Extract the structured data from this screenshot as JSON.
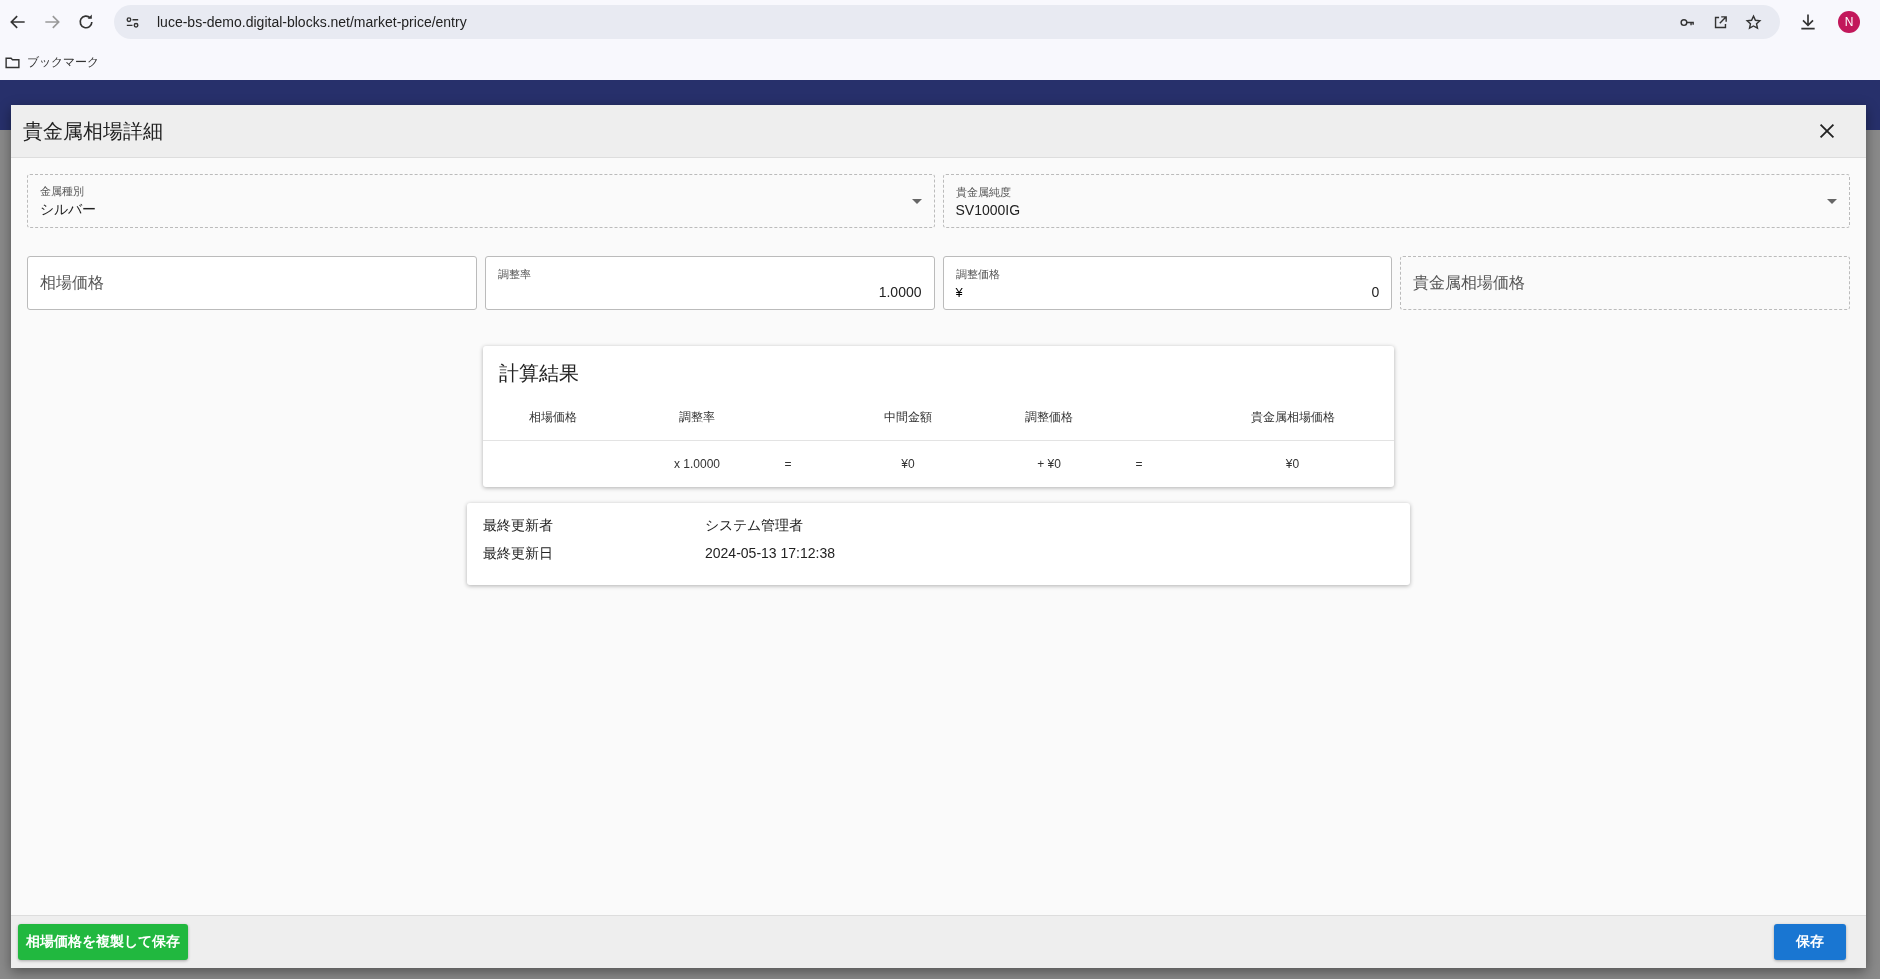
{
  "browser": {
    "url": "luce-bs-demo.digital-blocks.net/market-price/entry",
    "profile_initial": "N",
    "bookmarks_folder": "ブックマーク"
  },
  "dialog": {
    "title": "貴金属相場詳細",
    "field_rows": [
      [
        {
          "kind": "select",
          "label": "金属種別",
          "value": "シルバー",
          "disabled": true
        },
        {
          "kind": "select",
          "label": "貴金属純度",
          "value": "SV1000IG",
          "disabled": true
        }
      ],
      [
        {
          "kind": "text",
          "label": "相場価格",
          "disabled": false
        },
        {
          "kind": "text",
          "label": "調整率",
          "value": "1.0000",
          "disabled": false
        },
        {
          "kind": "text",
          "label": "調整価格",
          "prefix": "¥",
          "value": "0",
          "disabled": false
        },
        {
          "kind": "text",
          "label": "貴金属相場価格",
          "disabled": true
        }
      ]
    ],
    "calc": {
      "title": "計算結果",
      "columns": [
        {
          "header": "相場価格"
        },
        {
          "header": "調整率",
          "value": "x 1.0000"
        },
        {
          "value": "="
        },
        {
          "header": "中間金額",
          "value": "¥0"
        },
        {
          "header": "調整価格",
          "value": "+ ¥0"
        },
        {
          "value": "="
        },
        {
          "header": "貴金属相場価格",
          "value": "¥0"
        }
      ]
    },
    "info": [
      {
        "label": "最終更新者",
        "value": "システム管理者"
      },
      {
        "label": "最終更新日",
        "value": "2024-05-13 17:12:38"
      }
    ],
    "buttons": [
      {
        "kind": "secondary",
        "label": "相場価格を複製して保存"
      },
      {
        "kind": "primary",
        "label": "保存"
      }
    ]
  }
}
